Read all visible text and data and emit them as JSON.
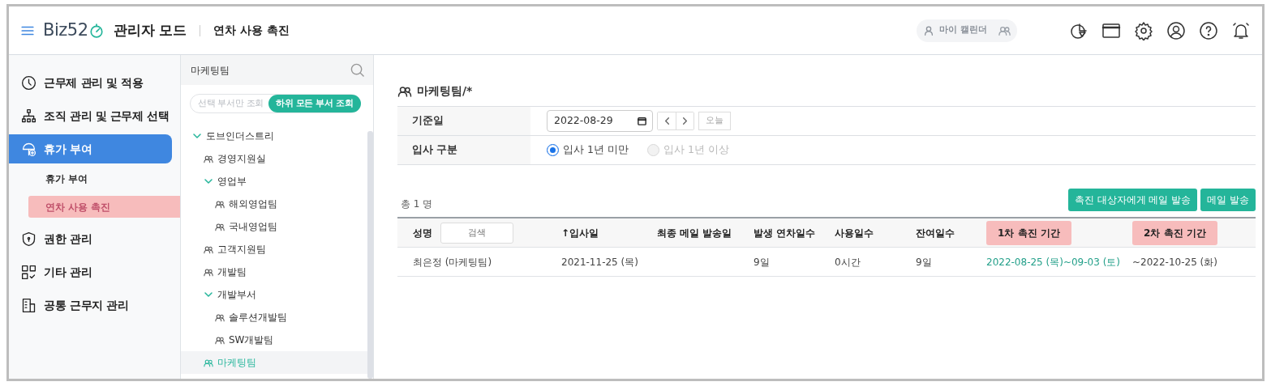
{
  "header": {
    "logo": "Biz52",
    "mode": "관리자 모드",
    "page_title": "연차 사용 촉진",
    "calendar_toggle": {
      "label": "마이 캘린더"
    }
  },
  "sidebar": {
    "items": [
      {
        "label": "근무제 관리 및 적용",
        "kind": "clock",
        "selected": false
      },
      {
        "label": "조직 관리 및 근무제 선택",
        "kind": "org",
        "selected": false
      },
      {
        "label": "휴가 부여",
        "kind": "vacation",
        "selected": true,
        "children": [
          {
            "label": "휴가 부여",
            "selected": false
          },
          {
            "label": "연차 사용 촉진",
            "selected": true
          }
        ]
      },
      {
        "label": "권한 관리",
        "kind": "shield",
        "selected": false
      },
      {
        "label": "기타 관리",
        "kind": "apps",
        "selected": false
      },
      {
        "label": "공통 근무지 관리",
        "kind": "building",
        "selected": false
      }
    ]
  },
  "tree": {
    "search_value": "마케팅팀",
    "scope_options": [
      {
        "label": "선택 부서만 조회",
        "selected": false
      },
      {
        "label": "하위 모든 부서 조회",
        "selected": true
      }
    ],
    "nodes": [
      {
        "label": "도브인더스트리",
        "selected": false,
        "expanded": true,
        "children": [
          {
            "label": "경영지원실",
            "selected": false
          },
          {
            "label": "영업부",
            "selected": false,
            "expanded": true,
            "children": [
              {
                "label": "해외영업팀",
                "selected": false
              },
              {
                "label": "국내영업팀",
                "selected": false
              }
            ]
          },
          {
            "label": "고객지원팀",
            "selected": false
          },
          {
            "label": "개발팀",
            "selected": false
          },
          {
            "label": "개발부서",
            "selected": false,
            "expanded": true,
            "children": [
              {
                "label": "솔루션개발팀",
                "selected": false
              },
              {
                "label": "SW개발팀",
                "selected": false
              }
            ]
          },
          {
            "label": "마케팅팀",
            "selected": true
          }
        ]
      }
    ]
  },
  "main": {
    "heading": "마케팅팀/*",
    "base_date": {
      "label": "기준일",
      "value": "2022-08-29",
      "today_button": "오늘"
    },
    "hire_type": {
      "label": "입사 구분",
      "options": [
        {
          "label": "입사 1년 미만",
          "selected": true,
          "disabled": false
        },
        {
          "label": "입사 1년 이상",
          "selected": false,
          "disabled": true
        }
      ]
    },
    "count": "총 1 명",
    "buttons": [
      "촉진 대상자에게 메일 발송",
      "메일 발송"
    ],
    "table": {
      "columns": [
        {
          "label": "성명",
          "search_placeholder": "검색",
          "highlighted": false
        },
        {
          "label": "↑입사일",
          "highlighted": false
        },
        {
          "label": "최종 메일 발송일",
          "highlighted": false
        },
        {
          "label": "발생 연차일수",
          "highlighted": false
        },
        {
          "label": "사용일수",
          "highlighted": false
        },
        {
          "label": "잔여일수",
          "highlighted": false
        },
        {
          "label": "1차 촉진 기간",
          "highlighted": true
        },
        {
          "label": "2차 촉진 기간",
          "highlighted": true
        }
      ],
      "rows": [
        {
          "name": "최은정 (마케팅팀)",
          "hire_date": "2021-11-25 (목)",
          "days_granted": "9일",
          "used": "0시간",
          "remaining": "9일",
          "first_period": {
            "text": "2022-08-25 (목)~09-03 (토)",
            "emphasis": true
          },
          "second_period": {
            "text": "~2022-10-25 (화)",
            "emphasis": false
          }
        }
      ]
    }
  }
}
